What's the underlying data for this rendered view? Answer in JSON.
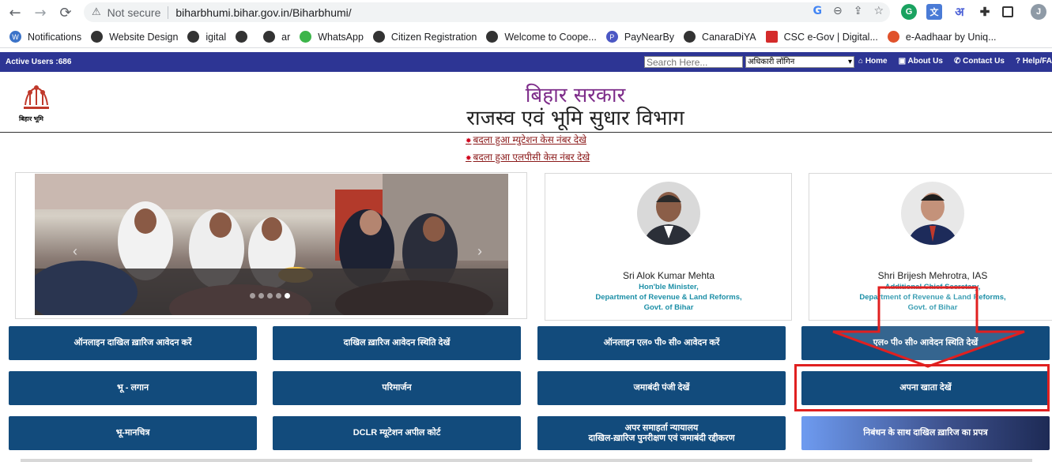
{
  "browser": {
    "back_icon": "←",
    "forward_icon": "→",
    "reload_icon": "⟳",
    "security_label": "Not secure",
    "url": "biharbhumi.bihar.gov.in/Biharbhumi/",
    "bookmarks": [
      {
        "label": "Notifications"
      },
      {
        "label": "Website Design"
      },
      {
        "label": "igital"
      },
      {
        "label": "ar"
      },
      {
        "label": "WhatsApp"
      },
      {
        "label": "Citizen Registration"
      },
      {
        "label": "Welcome to Coope..."
      },
      {
        "label": "PayNearBy"
      },
      {
        "label": "CanaraDiYA"
      },
      {
        "label": "CSC e-Gov | Digital..."
      },
      {
        "label": "e-Aadhaar by Uniq..."
      }
    ],
    "profile_initial": "J",
    "translate_label": "अ"
  },
  "topbar": {
    "active_users": "Active Users :686",
    "search_placeholder": "Search Here...",
    "login_select": "अधिकारी लॉगिन",
    "links": {
      "home": "Home",
      "about": "About Us",
      "contact": "Contact Us",
      "help": "Help/FA"
    }
  },
  "header": {
    "logo_text": "बिहार भूमि",
    "title1": "बिहार सरकार",
    "title2": "राजस्व एवं भूमि सुधार विभाग"
  },
  "news": {
    "link1": "बदला हुआ म्युटेशन केस नंबर देखे",
    "link2": "बदला हुआ एलपीसी केस नंबर देखे"
  },
  "profiles": [
    {
      "name": "Sri Alok Kumar Mehta",
      "role1": "Hon'ble Minister,",
      "role2": "Department of Revenue & Land Reforms,",
      "role3": "Govt. of Bihar"
    },
    {
      "name": "Shri Brijesh Mehrotra, IAS",
      "role1": "Additional Chief Secretary,",
      "role2": "Department of Revenue & Land Reforms,",
      "role3": "Govt. of Bihar"
    }
  ],
  "buttons": {
    "r1c1": "ऑनलाइन दाखिल ख़ारिज आवेदन करें",
    "r1c2": "दाखिल ख़ारिज आवेदन स्थिति देखें",
    "r1c3": "ऑनलाइन एल० पी० सी० आवेदन करें",
    "r1c4": "एल० पी० सी० आवेदन स्थिति देखें",
    "r2c1": "भू - लगान",
    "r2c2": "परिमार्जन",
    "r2c3": "जमाबंदी पंजी देखें",
    "r2c4": "अपना खाता देखें",
    "r3c1": "भू-मानचित्र",
    "r3c2": "DCLR म्यूटेशन अपील कोर्ट",
    "r3c3a": "अपर समाहर्ता न्यायालय",
    "r3c3b": "दाखिल-ख़ारिज पुनरीक्षण एवं जमाबंदी रद्दीकरण",
    "r3c4": "निबंधन के साथ दाखिल ख़ारिज का प्रपत्र"
  },
  "colors": {
    "topbar": "#2d3594",
    "button": "#124b7c",
    "highlight": "#e02020"
  }
}
